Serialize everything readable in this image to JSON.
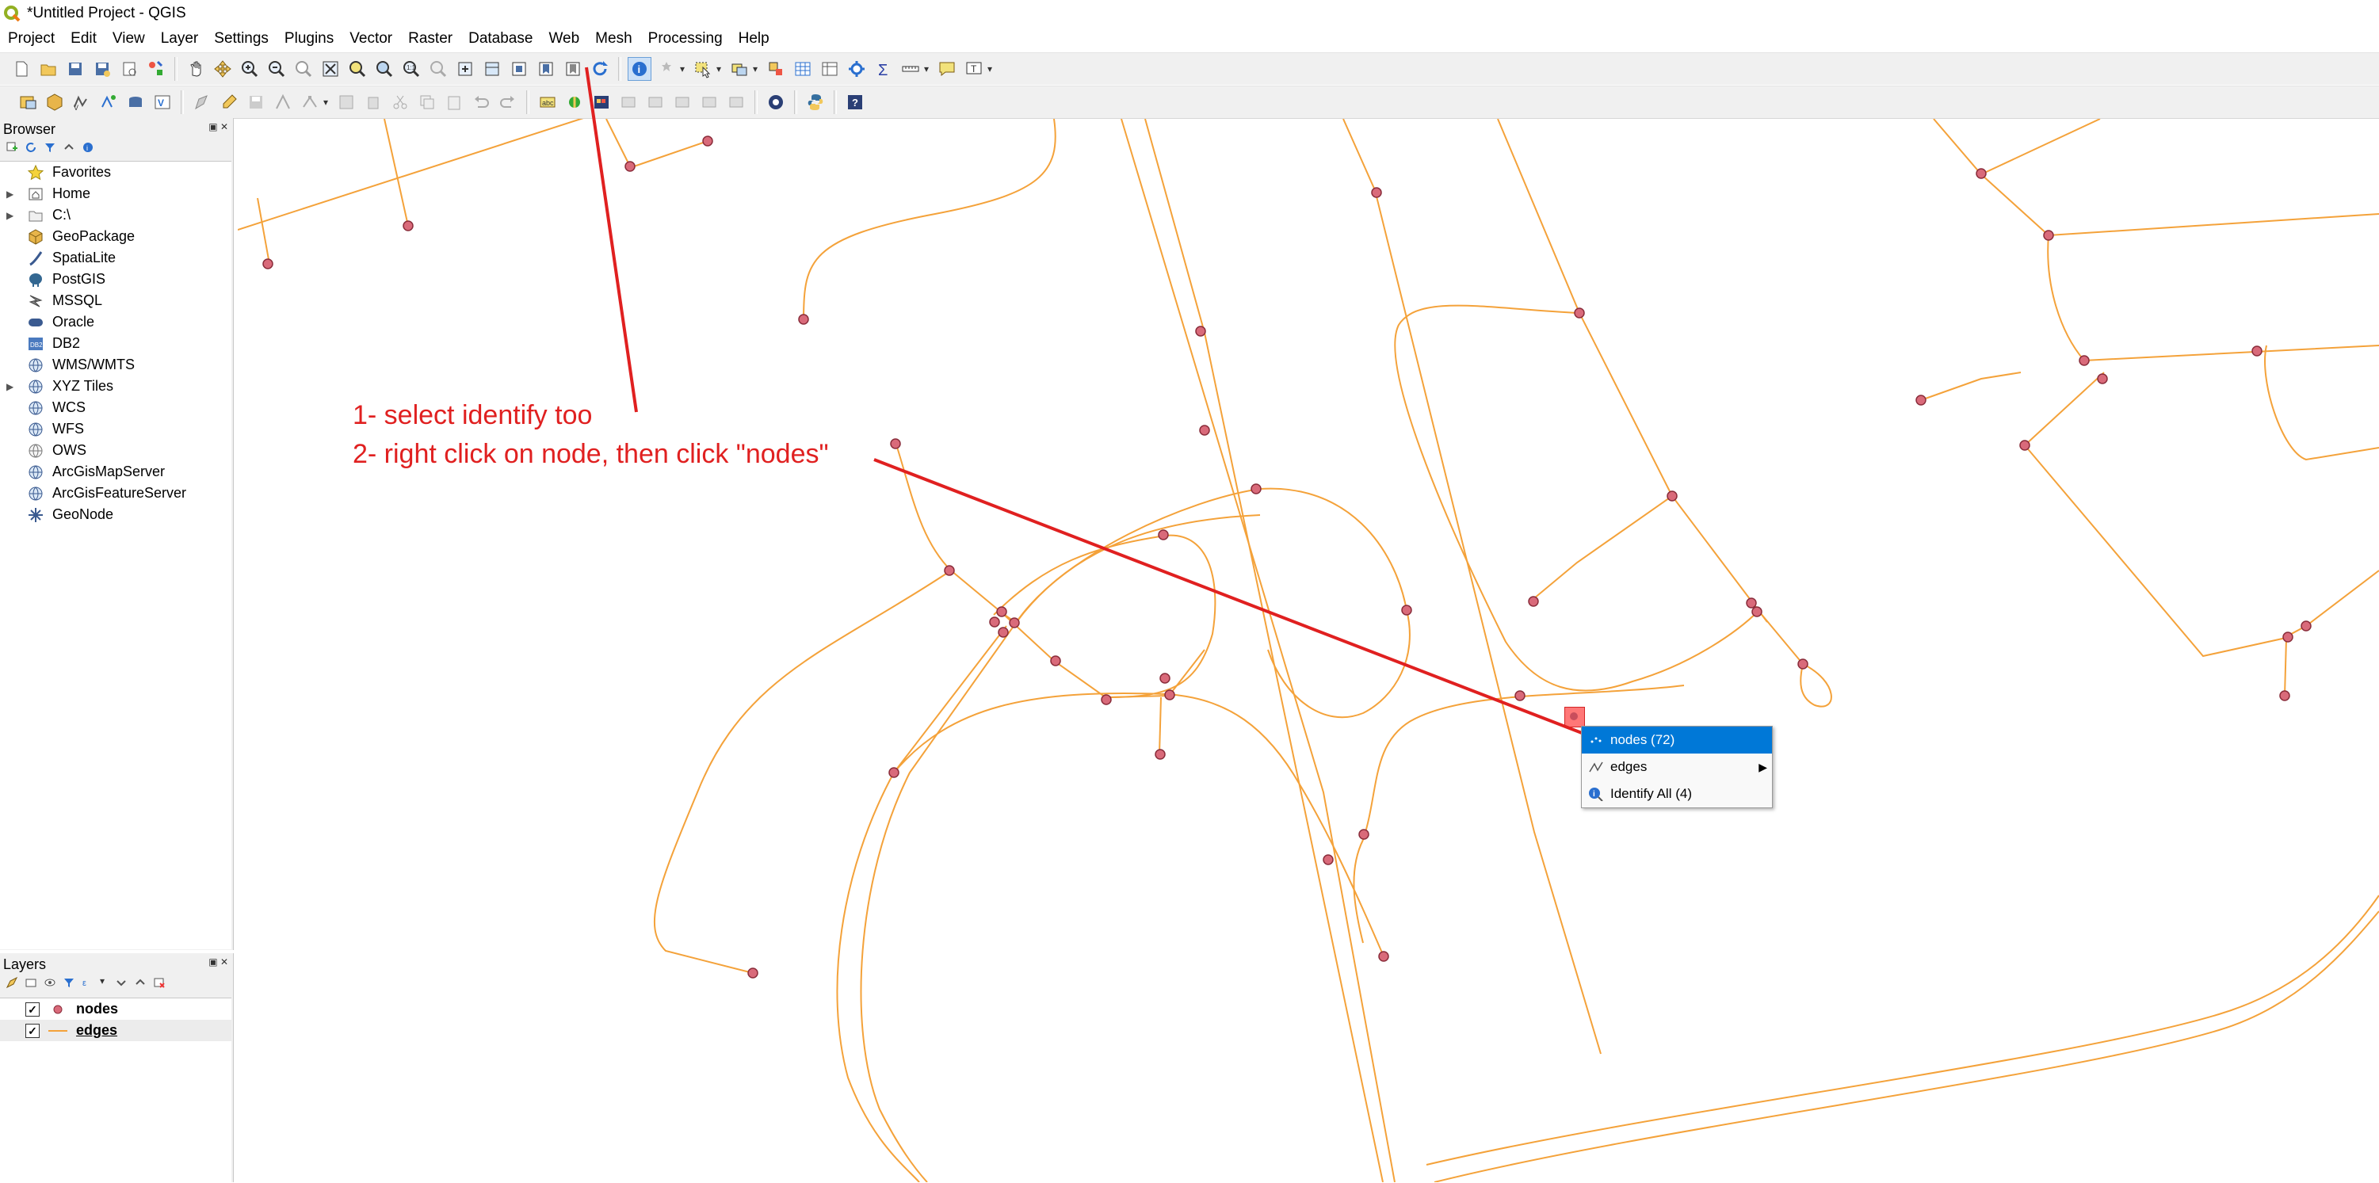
{
  "window": {
    "title": "*Untitled Project - QGIS",
    "logo_icon": "qgis-logo-icon"
  },
  "menubar": {
    "items": [
      {
        "label": "Project"
      },
      {
        "label": "Edit"
      },
      {
        "label": "View"
      },
      {
        "label": "Layer"
      },
      {
        "label": "Settings"
      },
      {
        "label": "Plugins"
      },
      {
        "label": "Vector"
      },
      {
        "label": "Raster"
      },
      {
        "label": "Database"
      },
      {
        "label": "Web"
      },
      {
        "label": "Mesh"
      },
      {
        "label": "Processing"
      },
      {
        "label": "Help"
      }
    ]
  },
  "toolbar": {
    "active_tool": "identify-features-icon"
  },
  "browser": {
    "title": "Browser",
    "items": [
      {
        "label": "Favorites",
        "icon": "star-icon",
        "expandable": false
      },
      {
        "label": "Home",
        "icon": "home-folder-icon",
        "expandable": true
      },
      {
        "label": "C:\\",
        "icon": "drive-icon",
        "expandable": true
      },
      {
        "label": "GeoPackage",
        "icon": "geopackage-icon",
        "expandable": false
      },
      {
        "label": "SpatiaLite",
        "icon": "spatialite-icon",
        "expandable": false
      },
      {
        "label": "PostGIS",
        "icon": "postgis-icon",
        "expandable": false
      },
      {
        "label": "MSSQL",
        "icon": "mssql-icon",
        "expandable": false
      },
      {
        "label": "Oracle",
        "icon": "oracle-icon",
        "expandable": false
      },
      {
        "label": "DB2",
        "icon": "db2-icon",
        "expandable": false
      },
      {
        "label": "WMS/WMTS",
        "icon": "globe-icon",
        "expandable": false
      },
      {
        "label": "XYZ Tiles",
        "icon": "globe-icon",
        "expandable": true
      },
      {
        "label": "WCS",
        "icon": "globe-icon",
        "expandable": false
      },
      {
        "label": "WFS",
        "icon": "globe-icon",
        "expandable": false
      },
      {
        "label": "OWS",
        "icon": "globe-icon",
        "expandable": false
      },
      {
        "label": "ArcGisMapServer",
        "icon": "globe-icon",
        "expandable": false
      },
      {
        "label": "ArcGisFeatureServer",
        "icon": "globe-icon",
        "expandable": false
      },
      {
        "label": "GeoNode",
        "icon": "geonode-icon",
        "expandable": false
      }
    ]
  },
  "layers": {
    "title": "Layers",
    "items": [
      {
        "label": "nodes",
        "checked": true,
        "symbol": "point"
      },
      {
        "label": "edges",
        "checked": true,
        "symbol": "line"
      }
    ]
  },
  "annotation": {
    "line1": "1- select identify too",
    "line2": "2- right click on node, then click \"nodes\"",
    "color": "#e02020"
  },
  "context_menu": {
    "items": [
      {
        "label": "nodes (72)",
        "icon": "point-layer-icon",
        "highlighted": true,
        "submenu": false
      },
      {
        "label": "edges",
        "icon": "line-layer-icon",
        "highlighted": false,
        "submenu": true
      },
      {
        "label": "Identify All (4)",
        "icon": "identify-icon",
        "highlighted": false,
        "submenu": false
      }
    ]
  },
  "colors": {
    "road": "#f4a23a",
    "node_fill": "#d96a7a",
    "menu_highlight": "#0078d7"
  }
}
